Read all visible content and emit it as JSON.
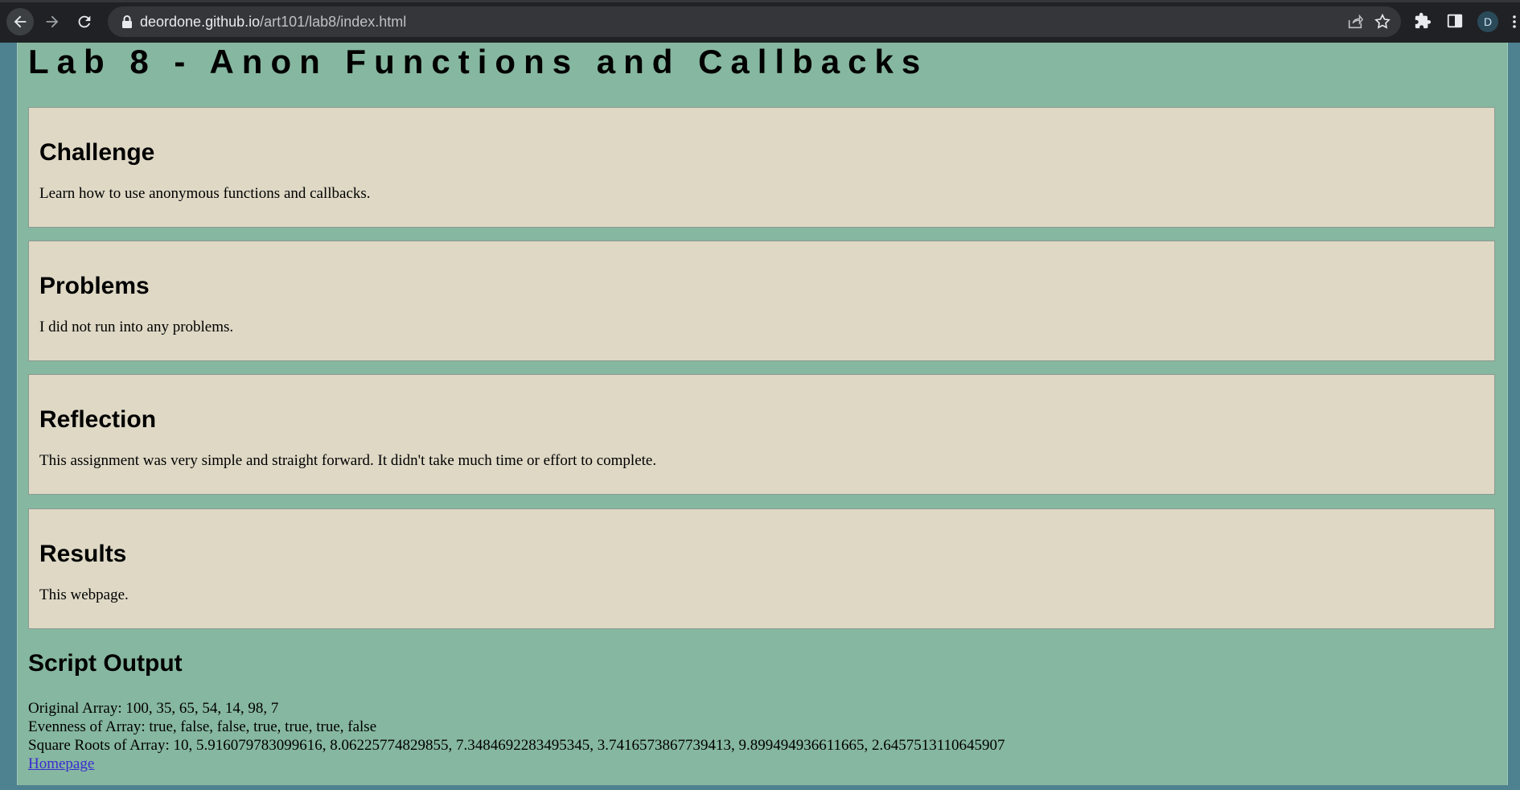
{
  "browser": {
    "url_host": "deordone.github.io",
    "url_path": "/art101/lab8/index.html",
    "profile_initial": "D"
  },
  "page": {
    "title": "Lab 8 - Anon Functions and Callbacks",
    "sections": [
      {
        "heading": "Challenge",
        "text": "Learn how to use anonymous functions and callbacks."
      },
      {
        "heading": "Problems",
        "text": "I did not run into any problems."
      },
      {
        "heading": "Reflection",
        "text": "This assignment was very simple and straight forward. It didn't take much time or effort to complete."
      },
      {
        "heading": "Results",
        "text": "This webpage."
      }
    ],
    "script_output": {
      "heading": "Script Output",
      "original_array": "Original Array: 100, 35, 65, 54, 14, 98, 7",
      "evenness": "Evenness of Array: true, false, false, true, true, true, false",
      "square_roots": "Square Roots of Array: 10, 5.916079783099616, 8.06225774829855, 7.3484692283495345, 3.7416573867739413, 9.899494936611665, 2.6457513110645907"
    },
    "homepage_link": "Homepage"
  },
  "colors": {
    "page_background": "#86b7a0",
    "card_background": "#ded8c5",
    "outer_background": "#4f8290",
    "link": "#3b2bd0"
  }
}
